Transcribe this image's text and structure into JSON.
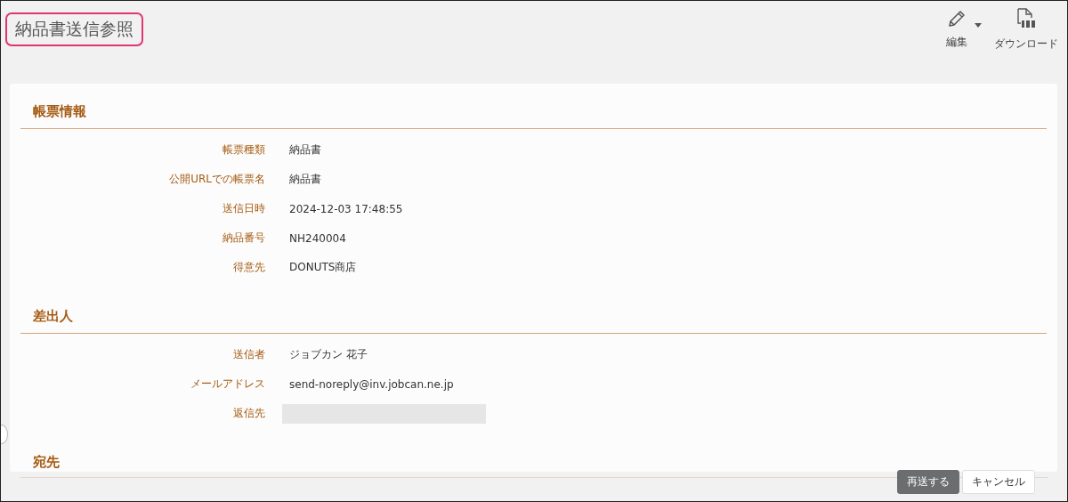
{
  "page_title": "納品書送信参照",
  "toolbar": [
    {
      "kind": "edit",
      "label": "編集"
    },
    {
      "kind": "pdf",
      "label": "ダウンロード"
    }
  ],
  "sections": [
    {
      "heading": "帳票情報",
      "fields": [
        {
          "label": "帳票種類",
          "value": "納品書"
        },
        {
          "label": "公開URLでの帳票名",
          "value": "納品書"
        },
        {
          "label": "送信日時",
          "value": "2024-12-03 17:48:55"
        },
        {
          "label": "納品番号",
          "value": "NH240004"
        },
        {
          "label": "得意先",
          "value": "DONUTS商店"
        }
      ]
    },
    {
      "heading": "差出人",
      "fields": [
        {
          "label": "送信者",
          "value": "ジョブカン 花子"
        },
        {
          "label": "メールアドレス",
          "value": "send-noreply@inv.jobcan.ne.jp"
        },
        {
          "label": "返信先",
          "kind": "blank"
        }
      ]
    },
    {
      "heading": "宛先"
    }
  ],
  "buttons": [
    {
      "label": "再送する",
      "primary": true
    },
    {
      "label": "キャンセル",
      "primary": false
    }
  ]
}
